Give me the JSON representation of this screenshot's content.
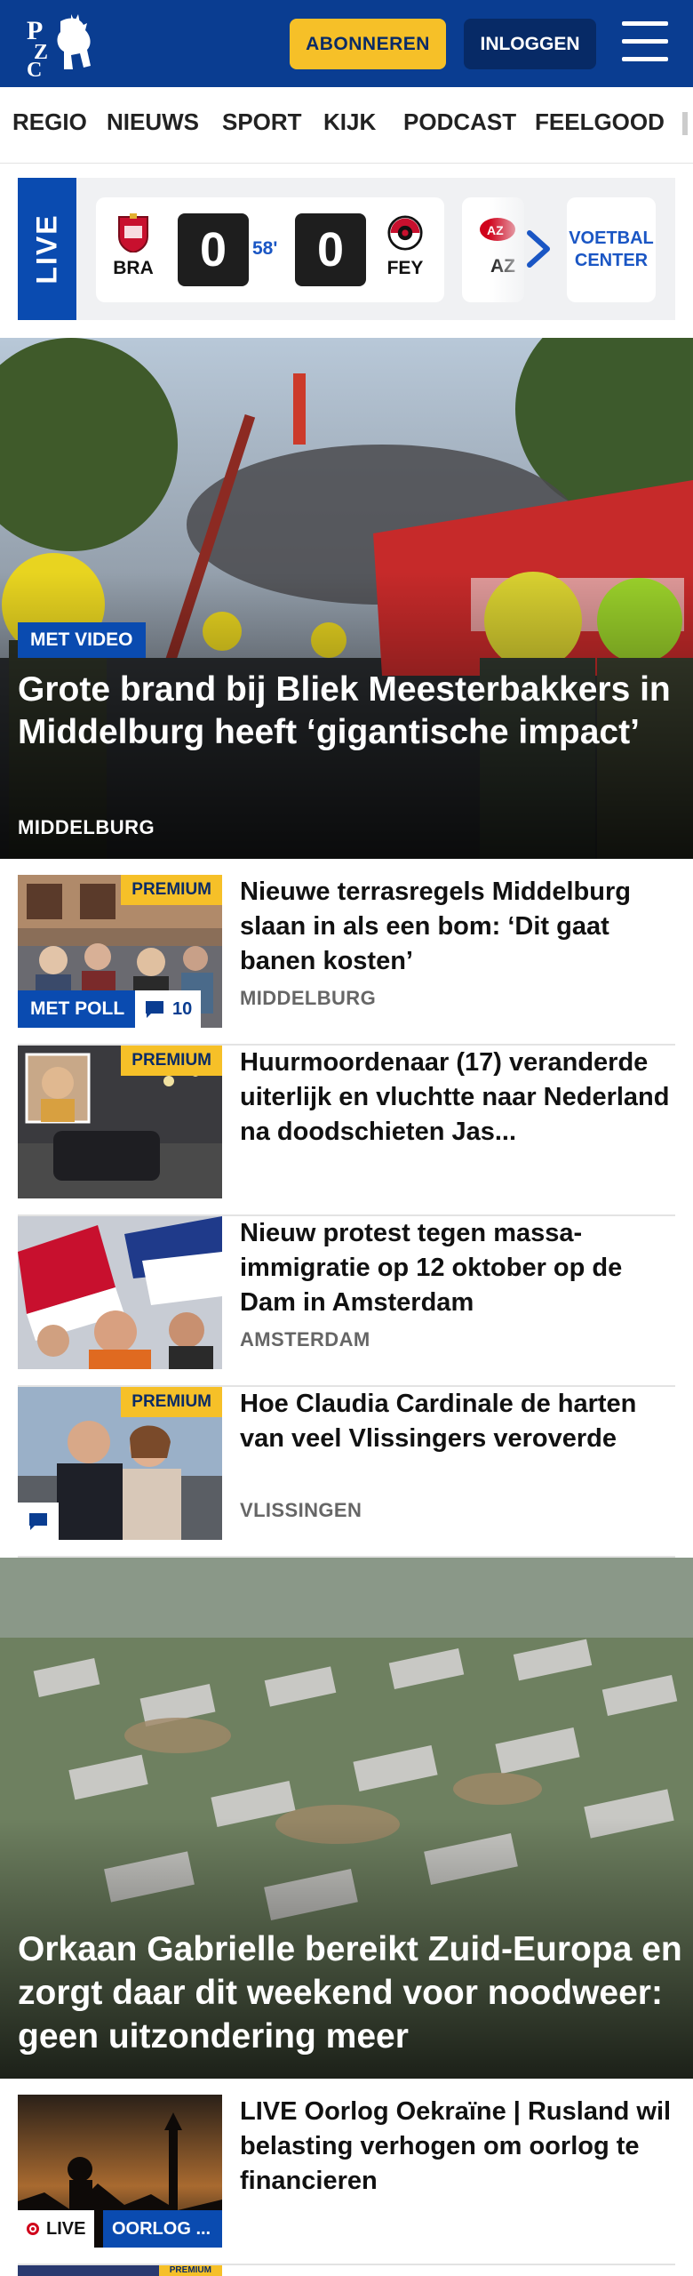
{
  "header": {
    "logo_text": "PZC",
    "subscribe_label": "ABONNEREN",
    "login_label": "INLOGGEN",
    "menu_icon": "hamburger-menu-icon",
    "brand_color": "#0a3d91",
    "accent_color": "#f6c028"
  },
  "nav": {
    "items": [
      "REGIO",
      "NIEUWS",
      "SPORT",
      "KIJK",
      "PODCAST",
      "FEELGOOD"
    ]
  },
  "live_bar": {
    "label": "LIVE",
    "match": {
      "home_abbr": "BRA",
      "home_score": "0",
      "minute": "58'",
      "away_score": "0",
      "away_abbr": "FEY"
    },
    "next_match_abbr": "AZ",
    "voetbal_center_line1": "VOETBAL",
    "voetbal_center_line2": "CENTER"
  },
  "hero": {
    "badge": "MET VIDEO",
    "title": "Grote brand bij Bliek Meesterbakkers in Middelburg heeft ‘gigantische impact’",
    "location": "MIDDELBURG"
  },
  "articles": [
    {
      "premium": "PREMIUM",
      "poll_badge": "MET POLL",
      "comments": "10",
      "title": "Nieuwe terrasregels Middelburg slaan in als een bom: ‘Dit gaat banen kosten’",
      "location": "MIDDELBURG"
    },
    {
      "premium": "PREMIUM",
      "title": "Huurmoordenaar (17) veranderde uiterlijk en vluchtte naar Nederland na doodschieten Jas..."
    },
    {
      "title": "Nieuw protest tegen massa-immigratie op 12 oktober op de Dam in Amsterdam",
      "location": "AMSTERDAM"
    },
    {
      "premium": "PREMIUM",
      "title": "Hoe Claudia Cardinale de harten van veel Vlissingers veroverde",
      "location": "VLISSINGEN"
    }
  ],
  "hero2": {
    "title": "Orkaan Gabrielle bereikt Zuid-Europa en zorgt daar dit weekend voor noodweer: geen uitzondering meer"
  },
  "last_article": {
    "live_label": "LIVE",
    "category": "OORLOG ...",
    "title": "LIVE Oorlog Oekraïne | Rusland wil belasting verhogen om oorlog te financieren"
  },
  "bottom_partial": {
    "premium": "PREMIUM"
  }
}
